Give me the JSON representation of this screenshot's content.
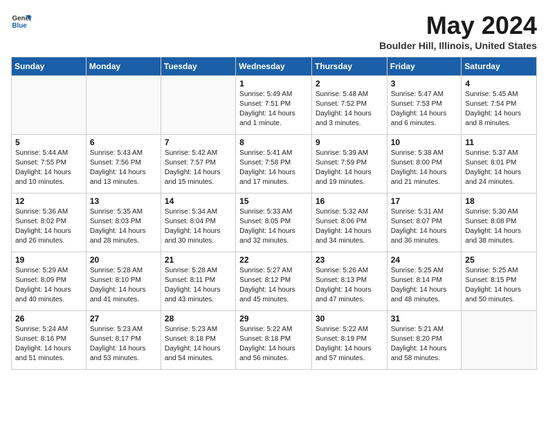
{
  "header": {
    "logo_general": "General",
    "logo_blue": "Blue",
    "month_title": "May 2024",
    "location": "Boulder Hill, Illinois, United States"
  },
  "weekdays": [
    "Sunday",
    "Monday",
    "Tuesday",
    "Wednesday",
    "Thursday",
    "Friday",
    "Saturday"
  ],
  "weeks": [
    [
      {
        "day": "",
        "sunrise": "",
        "sunset": "",
        "daylight": ""
      },
      {
        "day": "",
        "sunrise": "",
        "sunset": "",
        "daylight": ""
      },
      {
        "day": "",
        "sunrise": "",
        "sunset": "",
        "daylight": ""
      },
      {
        "day": "1",
        "sunrise": "Sunrise: 5:49 AM",
        "sunset": "Sunset: 7:51 PM",
        "daylight": "Daylight: 14 hours and 1 minute."
      },
      {
        "day": "2",
        "sunrise": "Sunrise: 5:48 AM",
        "sunset": "Sunset: 7:52 PM",
        "daylight": "Daylight: 14 hours and 3 minutes."
      },
      {
        "day": "3",
        "sunrise": "Sunrise: 5:47 AM",
        "sunset": "Sunset: 7:53 PM",
        "daylight": "Daylight: 14 hours and 6 minutes."
      },
      {
        "day": "4",
        "sunrise": "Sunrise: 5:45 AM",
        "sunset": "Sunset: 7:54 PM",
        "daylight": "Daylight: 14 hours and 8 minutes."
      }
    ],
    [
      {
        "day": "5",
        "sunrise": "Sunrise: 5:44 AM",
        "sunset": "Sunset: 7:55 PM",
        "daylight": "Daylight: 14 hours and 10 minutes."
      },
      {
        "day": "6",
        "sunrise": "Sunrise: 5:43 AM",
        "sunset": "Sunset: 7:56 PM",
        "daylight": "Daylight: 14 hours and 13 minutes."
      },
      {
        "day": "7",
        "sunrise": "Sunrise: 5:42 AM",
        "sunset": "Sunset: 7:57 PM",
        "daylight": "Daylight: 14 hours and 15 minutes."
      },
      {
        "day": "8",
        "sunrise": "Sunrise: 5:41 AM",
        "sunset": "Sunset: 7:58 PM",
        "daylight": "Daylight: 14 hours and 17 minutes."
      },
      {
        "day": "9",
        "sunrise": "Sunrise: 5:39 AM",
        "sunset": "Sunset: 7:59 PM",
        "daylight": "Daylight: 14 hours and 19 minutes."
      },
      {
        "day": "10",
        "sunrise": "Sunrise: 5:38 AM",
        "sunset": "Sunset: 8:00 PM",
        "daylight": "Daylight: 14 hours and 21 minutes."
      },
      {
        "day": "11",
        "sunrise": "Sunrise: 5:37 AM",
        "sunset": "Sunset: 8:01 PM",
        "daylight": "Daylight: 14 hours and 24 minutes."
      }
    ],
    [
      {
        "day": "12",
        "sunrise": "Sunrise: 5:36 AM",
        "sunset": "Sunset: 8:02 PM",
        "daylight": "Daylight: 14 hours and 26 minutes."
      },
      {
        "day": "13",
        "sunrise": "Sunrise: 5:35 AM",
        "sunset": "Sunset: 8:03 PM",
        "daylight": "Daylight: 14 hours and 28 minutes."
      },
      {
        "day": "14",
        "sunrise": "Sunrise: 5:34 AM",
        "sunset": "Sunset: 8:04 PM",
        "daylight": "Daylight: 14 hours and 30 minutes."
      },
      {
        "day": "15",
        "sunrise": "Sunrise: 5:33 AM",
        "sunset": "Sunset: 8:05 PM",
        "daylight": "Daylight: 14 hours and 32 minutes."
      },
      {
        "day": "16",
        "sunrise": "Sunrise: 5:32 AM",
        "sunset": "Sunset: 8:06 PM",
        "daylight": "Daylight: 14 hours and 34 minutes."
      },
      {
        "day": "17",
        "sunrise": "Sunrise: 5:31 AM",
        "sunset": "Sunset: 8:07 PM",
        "daylight": "Daylight: 14 hours and 36 minutes."
      },
      {
        "day": "18",
        "sunrise": "Sunrise: 5:30 AM",
        "sunset": "Sunset: 8:08 PM",
        "daylight": "Daylight: 14 hours and 38 minutes."
      }
    ],
    [
      {
        "day": "19",
        "sunrise": "Sunrise: 5:29 AM",
        "sunset": "Sunset: 8:09 PM",
        "daylight": "Daylight: 14 hours and 40 minutes."
      },
      {
        "day": "20",
        "sunrise": "Sunrise: 5:28 AM",
        "sunset": "Sunset: 8:10 PM",
        "daylight": "Daylight: 14 hours and 41 minutes."
      },
      {
        "day": "21",
        "sunrise": "Sunrise: 5:28 AM",
        "sunset": "Sunset: 8:11 PM",
        "daylight": "Daylight: 14 hours and 43 minutes."
      },
      {
        "day": "22",
        "sunrise": "Sunrise: 5:27 AM",
        "sunset": "Sunset: 8:12 PM",
        "daylight": "Daylight: 14 hours and 45 minutes."
      },
      {
        "day": "23",
        "sunrise": "Sunrise: 5:26 AM",
        "sunset": "Sunset: 8:13 PM",
        "daylight": "Daylight: 14 hours and 47 minutes."
      },
      {
        "day": "24",
        "sunrise": "Sunrise: 5:25 AM",
        "sunset": "Sunset: 8:14 PM",
        "daylight": "Daylight: 14 hours and 48 minutes."
      },
      {
        "day": "25",
        "sunrise": "Sunrise: 5:25 AM",
        "sunset": "Sunset: 8:15 PM",
        "daylight": "Daylight: 14 hours and 50 minutes."
      }
    ],
    [
      {
        "day": "26",
        "sunrise": "Sunrise: 5:24 AM",
        "sunset": "Sunset: 8:16 PM",
        "daylight": "Daylight: 14 hours and 51 minutes."
      },
      {
        "day": "27",
        "sunrise": "Sunrise: 5:23 AM",
        "sunset": "Sunset: 8:17 PM",
        "daylight": "Daylight: 14 hours and 53 minutes."
      },
      {
        "day": "28",
        "sunrise": "Sunrise: 5:23 AM",
        "sunset": "Sunset: 8:18 PM",
        "daylight": "Daylight: 14 hours and 54 minutes."
      },
      {
        "day": "29",
        "sunrise": "Sunrise: 5:22 AM",
        "sunset": "Sunset: 8:18 PM",
        "daylight": "Daylight: 14 hours and 56 minutes."
      },
      {
        "day": "30",
        "sunrise": "Sunrise: 5:22 AM",
        "sunset": "Sunset: 8:19 PM",
        "daylight": "Daylight: 14 hours and 57 minutes."
      },
      {
        "day": "31",
        "sunrise": "Sunrise: 5:21 AM",
        "sunset": "Sunset: 8:20 PM",
        "daylight": "Daylight: 14 hours and 58 minutes."
      },
      {
        "day": "",
        "sunrise": "",
        "sunset": "",
        "daylight": ""
      }
    ]
  ]
}
